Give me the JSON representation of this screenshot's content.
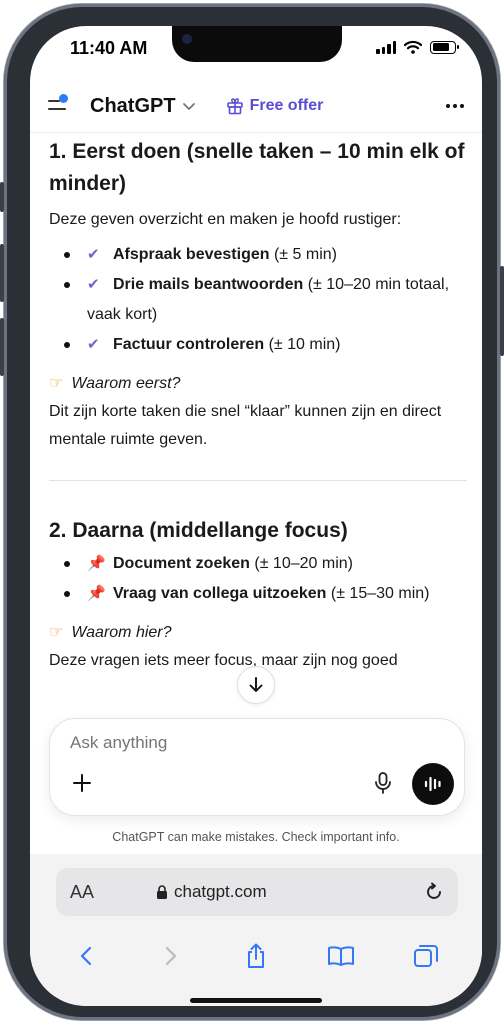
{
  "status": {
    "time": "11:40 AM"
  },
  "header": {
    "title": "ChatGPT",
    "offer_label": "Free offer"
  },
  "sections": [
    {
      "heading": "1. Eerst doen (snelle taken – 10 min elk of minder)",
      "intro": "Deze geven overzicht en maken je hoofd rustiger:",
      "items": [
        {
          "icon": "✔",
          "bold": "Afspraak bevestigen",
          "rest": " (± 5 min)"
        },
        {
          "icon": "✔",
          "bold": "Drie mails beantwoorden",
          "rest": " (± 10–20 min totaal, vaak kort)"
        },
        {
          "icon": "✔",
          "bold": "Factuur controleren",
          "rest": " (± 10 min)"
        }
      ],
      "why_label": "Waarom eerst?",
      "why_text": "Dit zijn korte taken die snel “klaar” kunnen zijn en direct mentale ruimte geven."
    },
    {
      "heading": "2. Daarna (middellange focus)",
      "items": [
        {
          "icon": "📌",
          "bold": "Document zoeken",
          "rest": " (± 10–20 min)"
        },
        {
          "icon": "📌",
          "bold": "Vraag van collega uitzoeken",
          "rest": " (± 15–30 min)"
        }
      ],
      "why_label": "Waarom hier?",
      "why_text": "Deze vragen iets meer focus, maar zijn nog goed"
    }
  ],
  "composer": {
    "placeholder": "Ask anything"
  },
  "disclaimer": "ChatGPT can make mistakes. Check important info.",
  "browser": {
    "aa_label": "AA",
    "url": "chatgpt.com"
  },
  "colors": {
    "accent": "#5b4bd5",
    "check": "#7f5bd6",
    "pin": "#d6324a",
    "notification_dot": "#2e7bf6"
  },
  "icons": [
    "menu-icon",
    "chevron-down-icon",
    "gift-icon",
    "more-icon",
    "arrow-down-icon",
    "plus-icon",
    "mic-icon",
    "voice-icon",
    "lock-icon",
    "reload-icon",
    "back-icon",
    "forward-icon",
    "share-icon",
    "bookmarks-icon",
    "tabs-icon"
  ]
}
